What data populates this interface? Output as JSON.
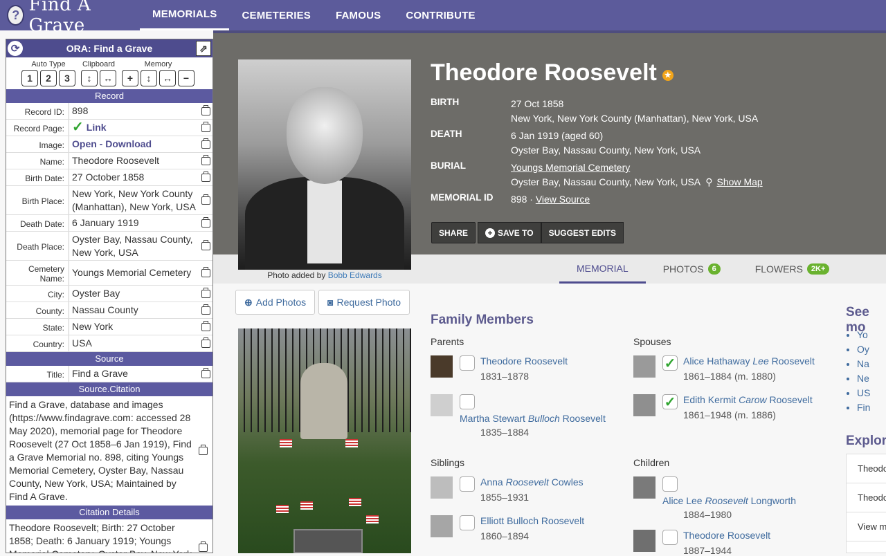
{
  "brand": {
    "logo_text": "Find A Grave"
  },
  "nav": {
    "items": [
      "MEMORIALS",
      "CEMETERIES",
      "FAMOUS",
      "CONTRIBUTE"
    ]
  },
  "ora": {
    "title": "ORA: Find a Grave",
    "tool_labels": {
      "auto_type": "Auto Type",
      "clipboard": "Clipboard",
      "memory": "Memory"
    },
    "auto_type_buttons": [
      "1",
      "2",
      "3"
    ],
    "sections": {
      "record": "Record",
      "source": "Source",
      "source_citation": "Source.Citation",
      "citation_details": "Citation Details"
    },
    "labels": {
      "record_id": "Record ID:",
      "record_page": "Record Page:",
      "image": "Image:",
      "name": "Name:",
      "birth_date": "Birth Date:",
      "birth_place": "Birth Place:",
      "death_date": "Death Date:",
      "death_place": "Death Place:",
      "cemetery_name": "Cemetery Name:",
      "city": "City:",
      "county": "County:",
      "state": "State:",
      "country": "Country:",
      "title": "Title:"
    },
    "values": {
      "record_id": "898",
      "record_page": "Link",
      "image": "Open - Download",
      "name": "Theodore Roosevelt",
      "birth_date": "27 October 1858",
      "birth_place": "New York, New York County (Manhattan), New York, USA",
      "death_date": "6 January 1919",
      "death_place": "Oyster Bay, Nassau County, New York, USA",
      "cemetery_name": "Youngs Memorial Cemetery",
      "city": "Oyster Bay",
      "county": "Nassau County",
      "state": "New York",
      "country": "USA",
      "title": "Find a Grave"
    },
    "source_citation": "Find a Grave, database and images (https://www.findagrave.com: accessed 28 May 2020), memorial page for Theodore Roosevelt (27 Oct 1858–6 Jan 1919), Find a Grave Memorial no. 898, citing Youngs Memorial Cemetery, Oyster Bay, Nassau County, New York, USA; Maintained by Find A Grave.",
    "citation_details": "Theodore Roosevelt; Birth: 27 October 1858; Death: 6 January 1919; Youngs Memorial Cemetery, Oyster Bay, New York, USA"
  },
  "memorial": {
    "name": "Theodore Roosevelt",
    "photo_caption_prefix": "Photo added by",
    "photo_caption_user": "Bobb Edwards",
    "birth_label": "BIRTH",
    "birth_date": "27 Oct 1858",
    "birth_place": "New York, New York County (Manhattan), New York, USA",
    "death_label": "DEATH",
    "death_date": "6 Jan 1919 (aged 60)",
    "death_place": "Oyster Bay, Nassau County, New York, USA",
    "burial_label": "BURIAL",
    "burial_cemetery": "Youngs Memorial Cemetery",
    "burial_place": "Oyster Bay, Nassau County, New York, USA",
    "show_map": "Show Map",
    "memorial_id_label": "MEMORIAL ID",
    "memorial_id": "898 ·",
    "view_source": "View Source",
    "actions": {
      "share": "SHARE",
      "save_to": "SAVE TO",
      "suggest_edits": "SUGGEST EDITS"
    },
    "tabs": [
      {
        "label": "MEMORIAL",
        "badge": ""
      },
      {
        "label": "PHOTOS",
        "badge": "6"
      },
      {
        "label": "FLOWERS",
        "badge": "2K+"
      }
    ],
    "add_photos": "Add Photos",
    "request_photo": "Request Photo"
  },
  "family": {
    "heading": "Family Members",
    "parents_label": "Parents",
    "spouses_label": "Spouses",
    "siblings_label": "Siblings",
    "children_label": "Children",
    "parents": [
      {
        "name": "Theodore Roosevelt",
        "dates": "1831–1878"
      },
      {
        "name_pre": "Martha Stewart ",
        "name_italic": "Bulloch",
        "name_post": " Roosevelt",
        "dates": "1835–1884"
      }
    ],
    "spouses": [
      {
        "name_pre": "Alice Hathaway ",
        "name_italic": "Lee",
        "name_post": " Roosevelt",
        "dates": "1861–1884 (m. 1880)"
      },
      {
        "name_pre": "Edith Kermit ",
        "name_italic": "Carow",
        "name_post": " Roosevelt",
        "dates": "1861–1948 (m. 1886)"
      }
    ],
    "siblings": [
      {
        "name_pre": "Anna ",
        "name_italic": "Roosevelt",
        "name_post": " Cowles",
        "dates": "1855–1931"
      },
      {
        "name": "Elliott Bulloch Roosevelt",
        "dates": "1860–1894"
      }
    ],
    "children": [
      {
        "name_pre": "Alice Lee ",
        "name_italic": "Roosevelt",
        "name_post": " Longworth",
        "dates": "1884–1980"
      },
      {
        "name": "Theodore Roosevelt",
        "dates": "1887–1944"
      }
    ]
  },
  "sidebar": {
    "see_more": "See mo",
    "see_more_items": [
      "Yo",
      "Oy",
      "Na",
      "Ne",
      "US",
      "Fin"
    ],
    "explore": "Explore",
    "explore_items": [
      "Theodo",
      "Theodo",
      "View m"
    ]
  }
}
